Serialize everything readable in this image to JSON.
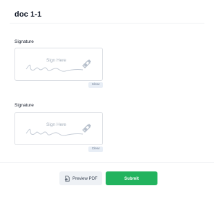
{
  "header": {
    "title": "doc 1-1"
  },
  "fields": [
    {
      "label": "Signature",
      "placeholder": "Sign Here",
      "clear_label": "Clear"
    },
    {
      "label": "Signature",
      "placeholder": "Sign Here",
      "clear_label": "Clear"
    }
  ],
  "footer": {
    "preview_label": "Preview PDF",
    "submit_label": "Submit"
  },
  "colors": {
    "submit": "#22b35e",
    "clear_bg": "#e8eef6",
    "border": "#dcdfe4"
  }
}
